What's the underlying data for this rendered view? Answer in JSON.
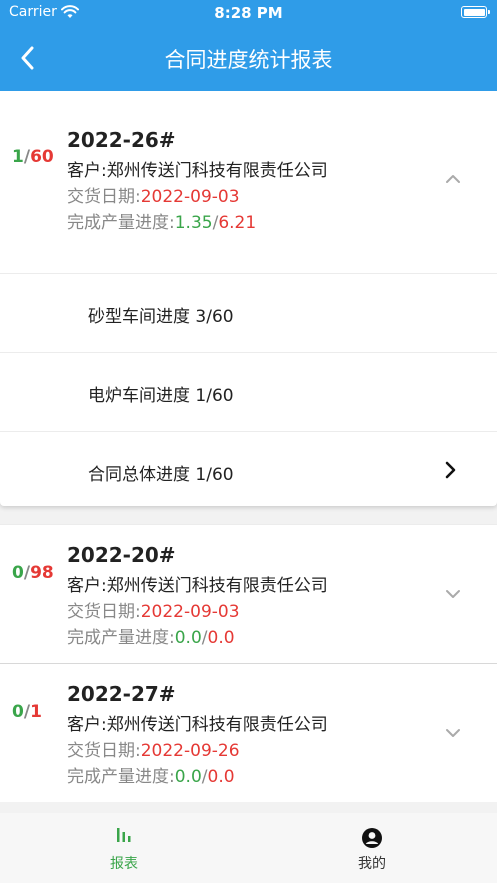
{
  "status_bar": {
    "carrier": "Carrier",
    "time": "8:28 PM"
  },
  "nav": {
    "title": "合同进度统计报表",
    "back_icon": "chevron-left-icon"
  },
  "colors": {
    "header": "#2f9ce8",
    "green": "#3aa54a",
    "red": "#e53935"
  },
  "contracts": [
    {
      "done": "1",
      "slash": "/",
      "total": "60",
      "code": "2022-26#",
      "client": "客户:郑州传送门科技有限责任公司",
      "delivery_label": "交货日期:",
      "delivery_date": "2022-09-03",
      "output_label": "完成产量进度:",
      "output_done": "1.35",
      "output_slash": "/",
      "output_total": "6.21",
      "expanded": true,
      "details": [
        {
          "label": "砂型车间进度 3/60"
        },
        {
          "label": "电炉车间进度 1/60"
        },
        {
          "label": "合同总体进度 1/60"
        }
      ]
    },
    {
      "done": "0",
      "slash": "/",
      "total": "98",
      "code": "2022-20#",
      "client": "客户:郑州传送门科技有限责任公司",
      "delivery_label": "交货日期:",
      "delivery_date": "2022-09-03",
      "output_label": "完成产量进度:",
      "output_done": "0.0",
      "output_slash": "/",
      "output_total": "0.0",
      "expanded": false
    },
    {
      "done": "0",
      "slash": "/",
      "total": "1",
      "code": "2022-27#",
      "client": "客户:郑州传送门科技有限责任公司",
      "delivery_label": "交货日期:",
      "delivery_date": "2022-09-26",
      "output_label": "完成产量进度:",
      "output_done": "0.0",
      "output_slash": "/",
      "output_total": "0.0",
      "expanded": false
    }
  ],
  "tabbar": {
    "tabs": [
      {
        "label": "报表",
        "icon": "bar-chart-icon",
        "active": true
      },
      {
        "label": "我的",
        "icon": "user-circle-icon",
        "active": false
      }
    ]
  }
}
